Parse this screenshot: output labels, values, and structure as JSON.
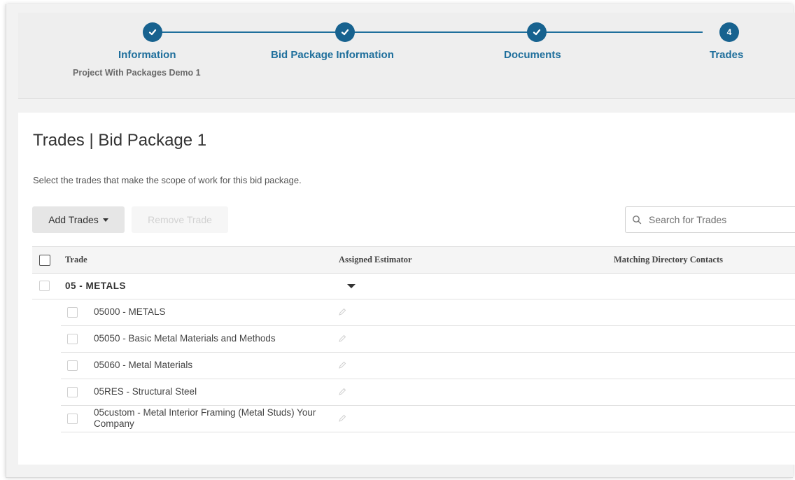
{
  "stepper": {
    "steps": [
      {
        "label": "Information",
        "sub": "Project With Packages Demo 1",
        "state": "complete"
      },
      {
        "label": "Bid Package Information",
        "state": "complete"
      },
      {
        "label": "Documents",
        "state": "complete"
      },
      {
        "label": "Trades",
        "number": "4",
        "state": "current"
      }
    ],
    "color": "#17628f"
  },
  "page": {
    "title": "Trades | Bid Package 1",
    "description": "Select the trades that make the scope of work for this bid package."
  },
  "toolbar": {
    "add_trades_label": "Add Trades",
    "remove_trade_label": "Remove Trade",
    "search_placeholder": "Search for Trades"
  },
  "table": {
    "columns": [
      "Trade",
      "Assigned Estimator",
      "Matching Directory Contacts"
    ],
    "group": {
      "label": "05 - METALS"
    },
    "rows": [
      {
        "trade": "05000 - METALS"
      },
      {
        "trade": "05050 - Basic Metal Materials and Methods"
      },
      {
        "trade": "05060 - Metal Materials"
      },
      {
        "trade": "05RES - Structural Steel"
      },
      {
        "trade": "05custom - Metal Interior Framing (Metal Studs) Your Company"
      }
    ]
  }
}
